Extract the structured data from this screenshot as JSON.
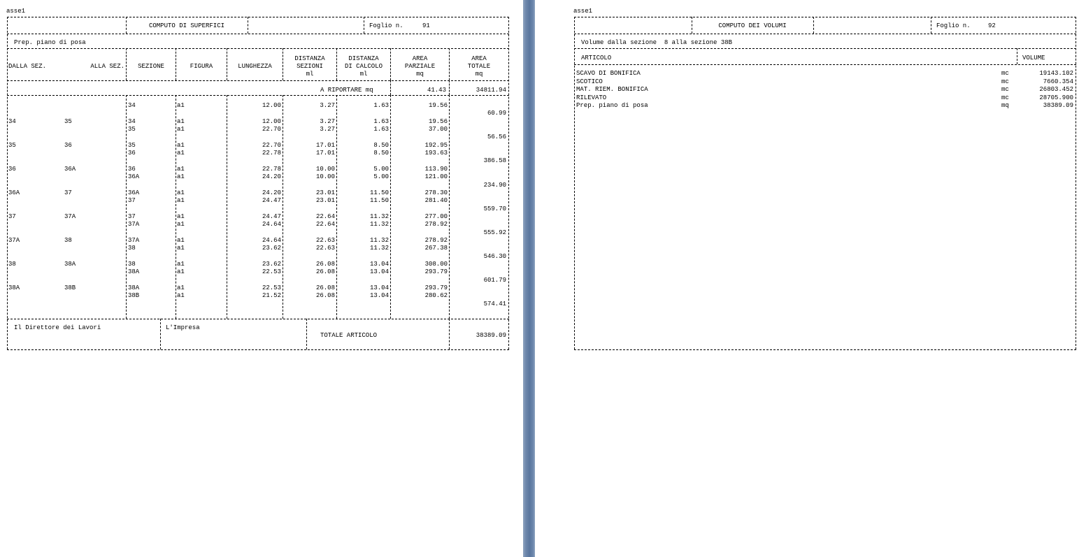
{
  "left": {
    "file_name": "asse1",
    "title": "COMPUTO DI SUPERFICI",
    "foglio_label": "Foglio n.",
    "foglio_num": "91",
    "category": "Prep. piano di posa",
    "headers": {
      "dalla": "DALLA SEZ.",
      "alla": "ALLA SEZ.",
      "sezione": "SEZIONE",
      "figura": "FIGURA",
      "lunghezza": "LUNGHEZZA",
      "dist_sez": [
        "DISTANZA",
        "SEZIONI",
        "ml"
      ],
      "dist_calc": [
        "DISTANZA",
        "DI CALCOLO",
        "ml"
      ],
      "area_parz": [
        "AREA",
        "PARZIALE",
        "mq"
      ],
      "area_tot": [
        "AREA",
        "TOTALE",
        "mq"
      ]
    },
    "riportare_label": "A RIPORTARE mq",
    "riportare_parz": "41.43",
    "riportare_tot": "34811.94",
    "rows": [
      {
        "dalla": "",
        "alla": "",
        "sez": "34",
        "fig": "a1",
        "lung": "12.00",
        "dsez": "3.27",
        "dcalc": "1.63",
        "apar": "19.56"
      },
      {
        "tot": "60.99"
      },
      {
        "dalla": "34",
        "alla": "35",
        "sez": "34",
        "fig": "a1",
        "lung": "12.00",
        "dsez": "3.27",
        "dcalc": "1.63",
        "apar": "19.56"
      },
      {
        "sez": "35",
        "fig": "a1",
        "lung": "22.70",
        "dsez": "3.27",
        "dcalc": "1.63",
        "apar": "37.00"
      },
      {
        "tot": "56.56"
      },
      {
        "dalla": "35",
        "alla": "36",
        "sez": "35",
        "fig": "a1",
        "lung": "22.70",
        "dsez": "17.01",
        "dcalc": "8.50",
        "apar": "192.95"
      },
      {
        "sez": "36",
        "fig": "a1",
        "lung": "22.78",
        "dsez": "17.01",
        "dcalc": "8.50",
        "apar": "193.63"
      },
      {
        "tot": "386.58"
      },
      {
        "dalla": "36",
        "alla": "36A",
        "sez": "36",
        "fig": "a1",
        "lung": "22.78",
        "dsez": "10.00",
        "dcalc": "5.00",
        "apar": "113.90"
      },
      {
        "sez": "36A",
        "fig": "a1",
        "lung": "24.20",
        "dsez": "10.00",
        "dcalc": "5.00",
        "apar": "121.00"
      },
      {
        "tot": "234.90"
      },
      {
        "dalla": "36A",
        "alla": "37",
        "sez": "36A",
        "fig": "a1",
        "lung": "24.20",
        "dsez": "23.01",
        "dcalc": "11.50",
        "apar": "278.30"
      },
      {
        "sez": "37",
        "fig": "a1",
        "lung": "24.47",
        "dsez": "23.01",
        "dcalc": "11.50",
        "apar": "281.40"
      },
      {
        "tot": "559.70"
      },
      {
        "dalla": "37",
        "alla": "37A",
        "sez": "37",
        "fig": "a1",
        "lung": "24.47",
        "dsez": "22.64",
        "dcalc": "11.32",
        "apar": "277.00"
      },
      {
        "sez": "37A",
        "fig": "a1",
        "lung": "24.64",
        "dsez": "22.64",
        "dcalc": "11.32",
        "apar": "278.92"
      },
      {
        "tot": "555.92"
      },
      {
        "dalla": "37A",
        "alla": "38",
        "sez": "37A",
        "fig": "a1",
        "lung": "24.64",
        "dsez": "22.63",
        "dcalc": "11.32",
        "apar": "278.92"
      },
      {
        "sez": "38",
        "fig": "a1",
        "lung": "23.62",
        "dsez": "22.63",
        "dcalc": "11.32",
        "apar": "267.38"
      },
      {
        "tot": "546.30"
      },
      {
        "dalla": "38",
        "alla": "38A",
        "sez": "38",
        "fig": "a1",
        "lung": "23.62",
        "dsez": "26.08",
        "dcalc": "13.04",
        "apar": "308.00"
      },
      {
        "sez": "38A",
        "fig": "a1",
        "lung": "22.53",
        "dsez": "26.08",
        "dcalc": "13.04",
        "apar": "293.79"
      },
      {
        "tot": "601.79"
      },
      {
        "dalla": "38A",
        "alla": "38B",
        "sez": "38A",
        "fig": "a1",
        "lung": "22.53",
        "dsez": "26.08",
        "dcalc": "13.04",
        "apar": "293.79"
      },
      {
        "sez": "38B",
        "fig": "a1",
        "lung": "21.52",
        "dsez": "26.08",
        "dcalc": "13.04",
        "apar": "280.62"
      },
      {
        "tot": "574.41"
      },
      {}
    ],
    "footer": {
      "direttore": "Il Direttore dei Lavori",
      "impresa": "L'Impresa",
      "totale_label": "TOTALE ARTICOLO",
      "totale_value": "38389.09"
    }
  },
  "right": {
    "file_name": "asse1",
    "title": "COMPUTO DEI VOLUMI",
    "foglio_label": "Foglio n.",
    "foglio_num": "92",
    "subtitle": "Volume dalla sezione  8 alla sezione 38B",
    "col_articolo": "ARTICOLO",
    "col_volume": "VOLUME",
    "items": [
      {
        "name": "SCAVO DI BONIFICA",
        "unit": "mc",
        "value": "19143.102"
      },
      {
        "name": "SCOTICO",
        "unit": "mc",
        "value": "7660.354"
      },
      {
        "name": "MAT. RIEM. BONIFICA",
        "unit": "mc",
        "value": "26803.452"
      },
      {
        "name": "RILEVATO",
        "unit": "mc",
        "value": "28705.900"
      },
      {
        "name": "Prep. piano di posa",
        "unit": "mq",
        "value": "38389.09"
      }
    ]
  }
}
